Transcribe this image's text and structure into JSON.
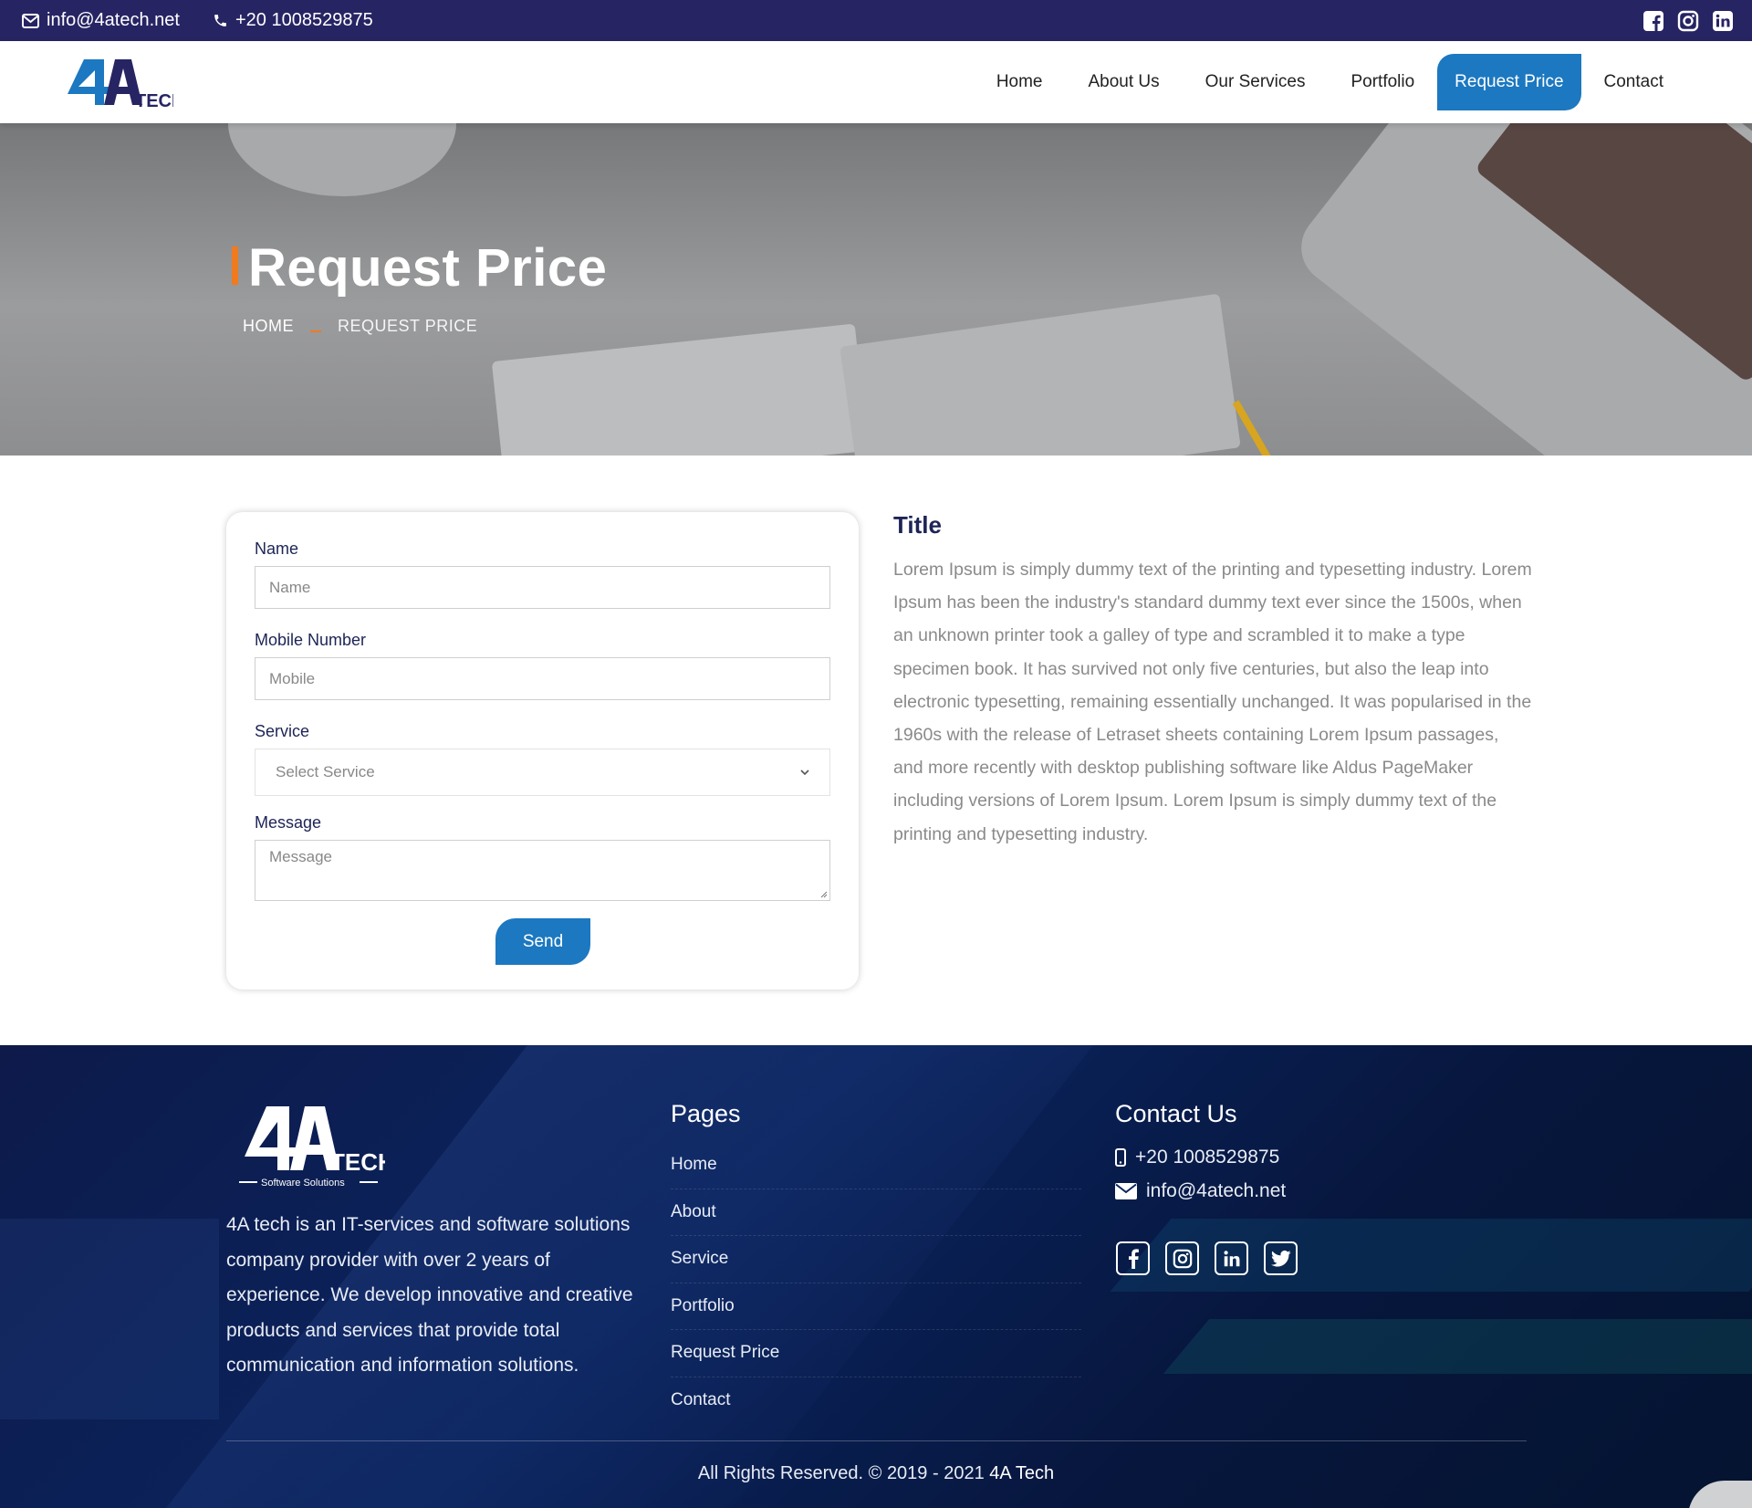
{
  "topbar": {
    "email": "info@4atech.net",
    "phone": "+20 1008529875",
    "social_icons": [
      "facebook-icon",
      "instagram-icon",
      "linkedin-icon"
    ]
  },
  "brand": {
    "logo_text_main": "4A",
    "logo_text_sub": "TECH"
  },
  "nav": {
    "items": [
      "Home",
      "About Us",
      "Our Services",
      "Portfolio",
      "Request Price",
      "Contact"
    ],
    "active": "Request Price"
  },
  "hero": {
    "title": "Request Price",
    "breadcrumb_home": "HOME",
    "breadcrumb_current": "REQUEST PRICE"
  },
  "form": {
    "name_label": "Name",
    "name_placeholder": "Name",
    "mobile_label": "Mobile Number",
    "mobile_placeholder": "Mobile",
    "service_label": "Service",
    "service_selected": "Select Service",
    "message_label": "Message",
    "message_placeholder": "Message",
    "send_label": "Send"
  },
  "info": {
    "title": "Title",
    "body": "Lorem Ipsum is simply dummy text of the printing and typesetting industry. Lorem Ipsum has been the industry's standard dummy text ever since the 1500s, when an unknown printer took a galley of type and scrambled it to make a type specimen book. It has survived not only five centuries, but also the leap into electronic typesetting, remaining essentially unchanged. It was popularised in the 1960s with the release of Letraset sheets containing Lorem Ipsum passages, and more recently with desktop publishing software like Aldus PageMaker including versions of Lorem Ipsum. Lorem Ipsum is simply dummy text of the printing and typesetting industry."
  },
  "footer": {
    "logo_main": "4A",
    "logo_sub": "TECH",
    "logo_tagline": "Software Solutions",
    "about": "4A tech is an IT-services and software solutions company provider with over 2 years of experience. We develop innovative and creative products and services that provide total communication and information solutions.",
    "pages_heading": "Pages",
    "pages": [
      "Home",
      "About",
      "Service",
      "Portfolio",
      "Request Price",
      "Contact"
    ],
    "contact_heading": "Contact Us",
    "phone": "+20 1008529875",
    "email": "info@4atech.net",
    "social_icons": [
      "facebook-icon",
      "instagram-icon",
      "linkedin-icon",
      "twitter-icon"
    ],
    "copyright": "All Rights Reserved. © 2019 - 2021",
    "copyright_brand": "4A Tech"
  },
  "colors": {
    "topbar": "#272464",
    "accent_blue": "#1c78c0",
    "accent_orange": "#f07a1f",
    "heading_navy": "#1d2455",
    "footer_bg": "#0a245e"
  }
}
